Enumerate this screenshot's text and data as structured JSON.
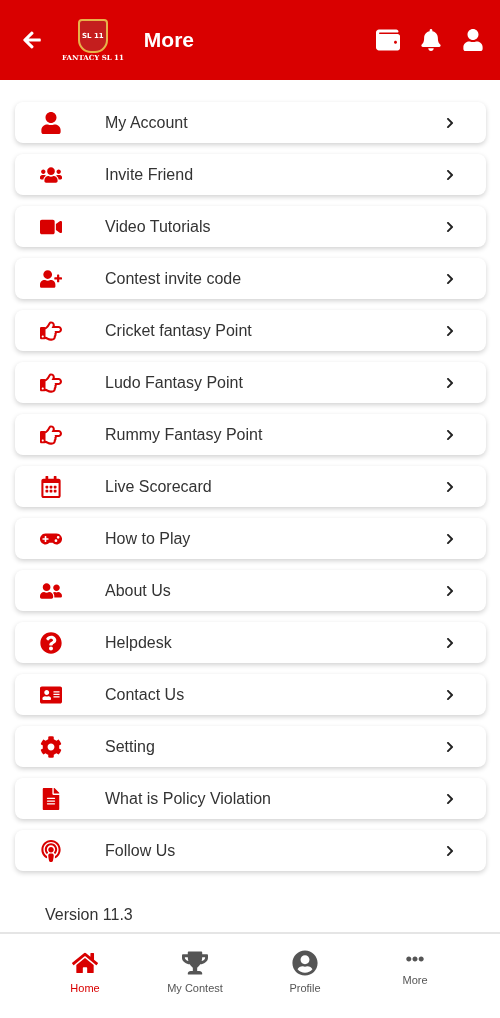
{
  "header": {
    "title": "More",
    "logo": {
      "badge": "SL 11",
      "caption": "FANTACY SL 11"
    }
  },
  "menu": [
    {
      "label": "My Account"
    },
    {
      "label": "Invite Friend"
    },
    {
      "label": "Video Tutorials"
    },
    {
      "label": "Contest invite code"
    },
    {
      "label": "Cricket fantasy Point"
    },
    {
      "label": "Ludo Fantasy Point"
    },
    {
      "label": "Rummy Fantasy Point"
    },
    {
      "label": "Live Scorecard"
    },
    {
      "label": "How to Play"
    },
    {
      "label": "About Us"
    },
    {
      "label": "Helpdesk"
    },
    {
      "label": "Contact Us"
    },
    {
      "label": "Setting"
    },
    {
      "label": "What is Policy Violation"
    },
    {
      "label": "Follow Us"
    }
  ],
  "version": "Version 11.3",
  "bottom_nav": [
    {
      "label": "Home",
      "selected": true
    },
    {
      "label": "My Contest",
      "selected": false
    },
    {
      "label": "Profile",
      "selected": false
    },
    {
      "label": "More",
      "selected": false
    }
  ]
}
